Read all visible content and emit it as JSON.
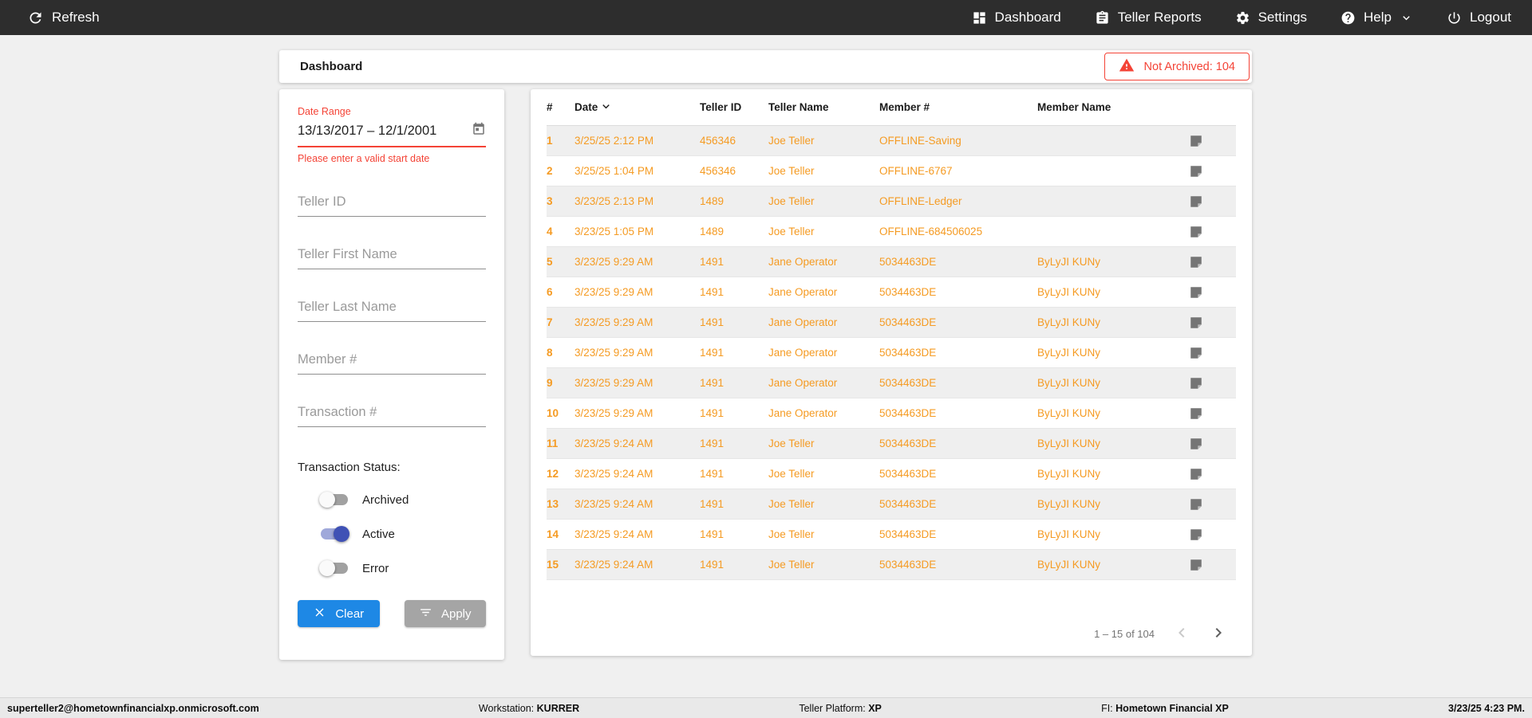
{
  "topnav": {
    "refresh_label": "Refresh",
    "items": [
      {
        "label": "Dashboard",
        "icon": "dashboard-grid-icon"
      },
      {
        "label": "Teller Reports",
        "icon": "clipboard-icon"
      },
      {
        "label": "Settings",
        "icon": "gear-icon"
      },
      {
        "label": "Help",
        "icon": "help-circle-icon",
        "dropdown": true
      },
      {
        "label": "Logout",
        "icon": "power-icon"
      }
    ]
  },
  "header": {
    "title": "Dashboard",
    "alert_badge": {
      "text": "Not Archived: 104",
      "icon": "warning-triangle-icon",
      "color": "#f44336"
    }
  },
  "filters": {
    "date_range": {
      "label": "Date Range",
      "value": "13/13/2017 – 12/1/2001",
      "error": "Please enter a valid start date",
      "icon": "calendar-icon"
    },
    "text_inputs": [
      {
        "placeholder": "Teller ID"
      },
      {
        "placeholder": "Teller First Name"
      },
      {
        "placeholder": "Teller Last Name"
      },
      {
        "placeholder": "Member #"
      },
      {
        "placeholder": "Transaction #"
      }
    ],
    "status": {
      "label": "Transaction Status:",
      "toggles": [
        {
          "label": "Archived",
          "on": false
        },
        {
          "label": "Active",
          "on": true
        },
        {
          "label": "Error",
          "on": false
        }
      ],
      "on_track_color": "#9fa8da",
      "on_thumb_color": "#3f51b5"
    },
    "clear_label": "Clear",
    "apply_label": "Apply",
    "clear_color": "#1e88e5",
    "apply_color": "#a5a5a5"
  },
  "table": {
    "columns": [
      "#",
      "Date",
      "Teller ID",
      "Teller Name",
      "Member #",
      "Member Name"
    ],
    "sorted_column": "Date",
    "row_text_color": "#f59b23",
    "note_icon": "note-icon",
    "rows": [
      {
        "num": "1",
        "date": "3/25/25 2:12 PM",
        "teller_id": "456346",
        "teller_name": "Joe Teller",
        "member_num": "OFFLINE-Saving",
        "member_name": ""
      },
      {
        "num": "2",
        "date": "3/25/25 1:04 PM",
        "teller_id": "456346",
        "teller_name": "Joe Teller",
        "member_num": "OFFLINE-6767",
        "member_name": ""
      },
      {
        "num": "3",
        "date": "3/23/25 2:13 PM",
        "teller_id": "1489",
        "teller_name": "Joe Teller",
        "member_num": "OFFLINE-Ledger",
        "member_name": ""
      },
      {
        "num": "4",
        "date": "3/23/25 1:05 PM",
        "teller_id": "1489",
        "teller_name": "Joe Teller",
        "member_num": "OFFLINE-684506025",
        "member_name": ""
      },
      {
        "num": "5",
        "date": "3/23/25 9:29 AM",
        "teller_id": "1491",
        "teller_name": "Jane Operator",
        "member_num": "5034463DE",
        "member_name": "ByLyJI KUNy"
      },
      {
        "num": "6",
        "date": "3/23/25 9:29 AM",
        "teller_id": "1491",
        "teller_name": "Jane Operator",
        "member_num": "5034463DE",
        "member_name": "ByLyJI KUNy"
      },
      {
        "num": "7",
        "date": "3/23/25 9:29 AM",
        "teller_id": "1491",
        "teller_name": "Jane Operator",
        "member_num": "5034463DE",
        "member_name": "ByLyJI KUNy"
      },
      {
        "num": "8",
        "date": "3/23/25 9:29 AM",
        "teller_id": "1491",
        "teller_name": "Jane Operator",
        "member_num": "5034463DE",
        "member_name": "ByLyJI KUNy"
      },
      {
        "num": "9",
        "date": "3/23/25 9:29 AM",
        "teller_id": "1491",
        "teller_name": "Jane Operator",
        "member_num": "5034463DE",
        "member_name": "ByLyJI KUNy"
      },
      {
        "num": "10",
        "date": "3/23/25 9:29 AM",
        "teller_id": "1491",
        "teller_name": "Jane Operator",
        "member_num": "5034463DE",
        "member_name": "ByLyJI KUNy"
      },
      {
        "num": "11",
        "date": "3/23/25 9:24 AM",
        "teller_id": "1491",
        "teller_name": "Joe Teller",
        "member_num": "5034463DE",
        "member_name": "ByLyJI KUNy"
      },
      {
        "num": "12",
        "date": "3/23/25 9:24 AM",
        "teller_id": "1491",
        "teller_name": "Joe Teller",
        "member_num": "5034463DE",
        "member_name": "ByLyJI KUNy"
      },
      {
        "num": "13",
        "date": "3/23/25 9:24 AM",
        "teller_id": "1491",
        "teller_name": "Joe Teller",
        "member_num": "5034463DE",
        "member_name": "ByLyJI KUNy"
      },
      {
        "num": "14",
        "date": "3/23/25 9:24 AM",
        "teller_id": "1491",
        "teller_name": "Joe Teller",
        "member_num": "5034463DE",
        "member_name": "ByLyJI KUNy"
      },
      {
        "num": "15",
        "date": "3/23/25 9:24 AM",
        "teller_id": "1491",
        "teller_name": "Joe Teller",
        "member_num": "5034463DE",
        "member_name": "ByLyJI KUNy"
      }
    ],
    "pagination": {
      "range_label": "1 – 15 of 104",
      "prev_icon": "chevron-left-icon",
      "next_icon": "chevron-right-icon"
    }
  },
  "footer": {
    "email": "superteller2@hometownfinancialxp.onmicrosoft.com",
    "workstation_label": "Workstation:",
    "workstation_value": "KURRER",
    "platform_label": "Teller Platform:",
    "platform_value": "XP",
    "fi_label": "FI:",
    "fi_value": "Hometown Financial XP",
    "timestamp": "3/23/25 4:23 PM."
  }
}
